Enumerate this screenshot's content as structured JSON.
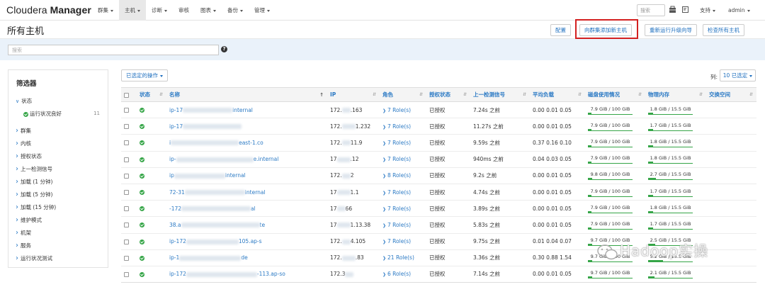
{
  "brand": {
    "name_light": "Cloudera",
    "name_bold": "Manager"
  },
  "nav": {
    "items": [
      {
        "label": "群集",
        "active": false
      },
      {
        "label": "主机",
        "active": true
      },
      {
        "label": "诊断",
        "active": false
      },
      {
        "label": "审核",
        "active": false,
        "no_caret": true
      },
      {
        "label": "图表",
        "active": false
      },
      {
        "label": "备份",
        "active": false
      },
      {
        "label": "管理",
        "active": false
      }
    ],
    "search_placeholder": "搜索",
    "support_label": "支持",
    "user_label": "admin"
  },
  "title_bar": {
    "title": "所有主机",
    "config_button": "配置",
    "add_hosts_button": "向群集添加新主机",
    "rerun_upgrade_button": "重新运行升级向导",
    "inspect_all_button": "检查所有主机"
  },
  "search": {
    "placeholder": "搜索",
    "help_glyph": "?"
  },
  "filters": {
    "title": "筛选器",
    "status_group": "状态",
    "status_good_label": "运行状况良好",
    "status_good_count": "11",
    "items": [
      "群集",
      "内核",
      "授权状态",
      "上一检测信号",
      "加载 (1 分钟)",
      "加载 (5 分钟)",
      "加载 (15 分钟)",
      "维护模式",
      "机架",
      "服务",
      "运行状况测试"
    ]
  },
  "toolbar": {
    "selected_actions": "已选定的操作",
    "columns_label": "列:",
    "columns_button": "10 已选定"
  },
  "table": {
    "headers": [
      "状态",
      "名称",
      "IP",
      "角色",
      "授权状态",
      "上一检测信号",
      "平均负载",
      "磁盘使用情况",
      "物理内存",
      "交换空间"
    ],
    "rows": [
      {
        "name_start": "ip-17",
        "name_end": "internal",
        "ip_start": "172.",
        "ip_end": ".163",
        "roles": "7 Role(s)",
        "auth": "已授权",
        "heartbeat": "7.24s 之前",
        "load": "0.00  0.01  0.05",
        "disk": "7.9 GiB / 100 GiB",
        "disk_pct": 0.079,
        "mem": "1.8 GiB / 15.5 GiB",
        "mem_pct": 0.116
      },
      {
        "name_start": "ip-17",
        "name_end": "",
        "ip_start": "172.",
        "ip_end": "1.232",
        "roles": "7 Role(s)",
        "auth": "已授权",
        "heartbeat": "11.27s 之前",
        "load": "0.00  0.01  0.05",
        "disk": "7.9 GiB / 100 GiB",
        "disk_pct": 0.079,
        "mem": "1.7 GiB / 15.5 GiB",
        "mem_pct": 0.11
      },
      {
        "name_start": "i",
        "name_end": "east-1.co",
        "ip_start": "172.",
        "ip_end": "11.9",
        "roles": "7 Role(s)",
        "auth": "已授权",
        "heartbeat": "9.59s 之前",
        "load": "0.37  0.16  0.10",
        "disk": "7.9 GiB / 100 GiB",
        "disk_pct": 0.079,
        "mem": "1.8 GiB / 15.5 GiB",
        "mem_pct": 0.116
      },
      {
        "name_start": "ip-",
        "name_end": "e.internal",
        "ip_start": "17",
        "ip_end": ".12",
        "roles": "7 Role(s)",
        "auth": "已授权",
        "heartbeat": "940ms 之前",
        "load": "0.04  0.03  0.05",
        "disk": "7.9 GiB / 100 GiB",
        "disk_pct": 0.079,
        "mem": "1.8 GiB / 15.5 GiB",
        "mem_pct": 0.116
      },
      {
        "name_start": "ip",
        "name_end": "internal",
        "ip_start": "172.",
        "ip_end": "2",
        "roles": "8 Role(s)",
        "auth": "已授权",
        "heartbeat": "9.2s 之前",
        "load": "0.00  0.01  0.05",
        "disk": "9.8 GiB / 100 GiB",
        "disk_pct": 0.098,
        "mem": "2.7 GiB / 15.5 GiB",
        "mem_pct": 0.174
      },
      {
        "name_start": "72-31",
        "name_end": "internal",
        "ip_start": "17",
        "ip_end": "1.1",
        "roles": "7 Role(s)",
        "auth": "已授权",
        "heartbeat": "4.74s 之前",
        "load": "0.00  0.01  0.05",
        "disk": "7.9 GiB / 100 GiB",
        "disk_pct": 0.079,
        "mem": "1.7 GiB / 15.5 GiB",
        "mem_pct": 0.11
      },
      {
        "name_start": "-172",
        "name_end": "al",
        "ip_start": "17",
        "ip_end": "66",
        "roles": "7 Role(s)",
        "auth": "已授权",
        "heartbeat": "3.89s 之前",
        "load": "0.00  0.01  0.05",
        "disk": "7.9 GiB / 100 GiB",
        "disk_pct": 0.079,
        "mem": "1.8 GiB / 15.5 GiB",
        "mem_pct": 0.116
      },
      {
        "name_start": "38.a",
        "name_end": "te",
        "ip_start": "17",
        "ip_end": "1.13.38",
        "roles": "7 Role(s)",
        "auth": "已授权",
        "heartbeat": "5.83s 之前",
        "load": "0.00  0.01  0.05",
        "disk": "7.9 GiB / 100 GiB",
        "disk_pct": 0.079,
        "mem": "1.7 GiB / 15.5 GiB",
        "mem_pct": 0.11
      },
      {
        "name_start": "ip-172",
        "name_end": "105.ap-s",
        "ip_start": "172.",
        "ip_end": "4.105",
        "roles": "7 Role(s)",
        "auth": "已授权",
        "heartbeat": "9.75s 之前",
        "load": "0.01  0.04  0.07",
        "disk": "9.7 GiB / 100 GiB",
        "disk_pct": 0.097,
        "mem": "2.5 GiB / 15.5 GiB",
        "mem_pct": 0.161
      },
      {
        "name_start": "ip-1",
        "name_end": "de",
        "ip_start": "172.",
        "ip_end": ".83",
        "roles": "21 Role(s)",
        "auth": "已授权",
        "heartbeat": "3.36s 之前",
        "load": "0.30  0.88  1.54",
        "disk": "9.7 GiB / 100 GiB",
        "disk_pct": 0.097,
        "mem": "5.2 GiB / 15.5 GiB",
        "mem_pct": 0.335
      },
      {
        "name_start": "ip-172",
        "name_end": "-113.ap-so",
        "ip_start": "172.3",
        "ip_end": "",
        "roles": "6 Role(s)",
        "auth": "已授权",
        "heartbeat": "7.14s 之前",
        "load": "0.00  0.01  0.05",
        "disk": "9.7 GiB / 100 GiB",
        "disk_pct": 0.097,
        "mem": "2.1 GiB / 15.5 GiB",
        "mem_pct": 0.135
      }
    ]
  },
  "watermark": {
    "text": "Hadoop实操"
  },
  "colors": {
    "link": "#2a79c4",
    "ok": "#35a547",
    "highlight": "#d32020",
    "search_bg": "#eaf2fa"
  }
}
